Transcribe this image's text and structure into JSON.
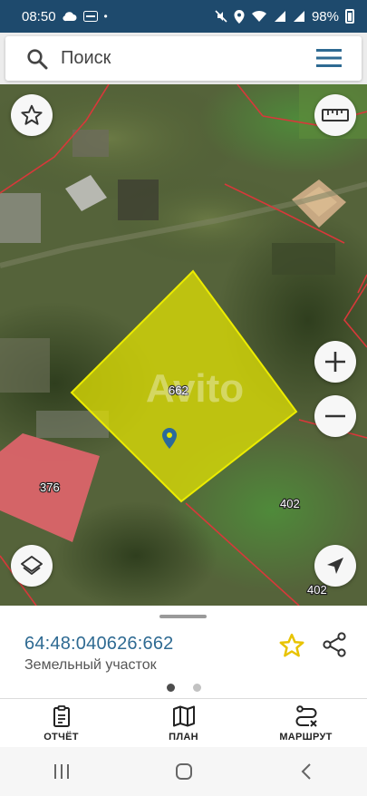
{
  "status_bar": {
    "time": "08:50",
    "battery": "98%"
  },
  "search": {
    "placeholder": "Поиск"
  },
  "map": {
    "watermark": "Avito",
    "selected_parcel_label": "662",
    "parcel_labels": [
      "376",
      "402",
      "402"
    ],
    "highlight_color": "#e8e800",
    "boundary_color": "#d8383a",
    "building_color": "#e0646b"
  },
  "info_panel": {
    "cadastral_number": "64:48:040626:662",
    "land_type": "Земельный участок",
    "page_dots": {
      "count": 2,
      "active": 1
    }
  },
  "bottom_nav": {
    "items": [
      {
        "label": "ОТЧЁТ",
        "icon": "clipboard-icon"
      },
      {
        "label": "ПЛАН",
        "icon": "map-icon"
      },
      {
        "label": "МАРШРУТ",
        "icon": "route-icon"
      }
    ]
  },
  "colors": {
    "status_bar": "#1e4a6d",
    "accent": "#2e6a92",
    "favorite": "#e8c300"
  }
}
